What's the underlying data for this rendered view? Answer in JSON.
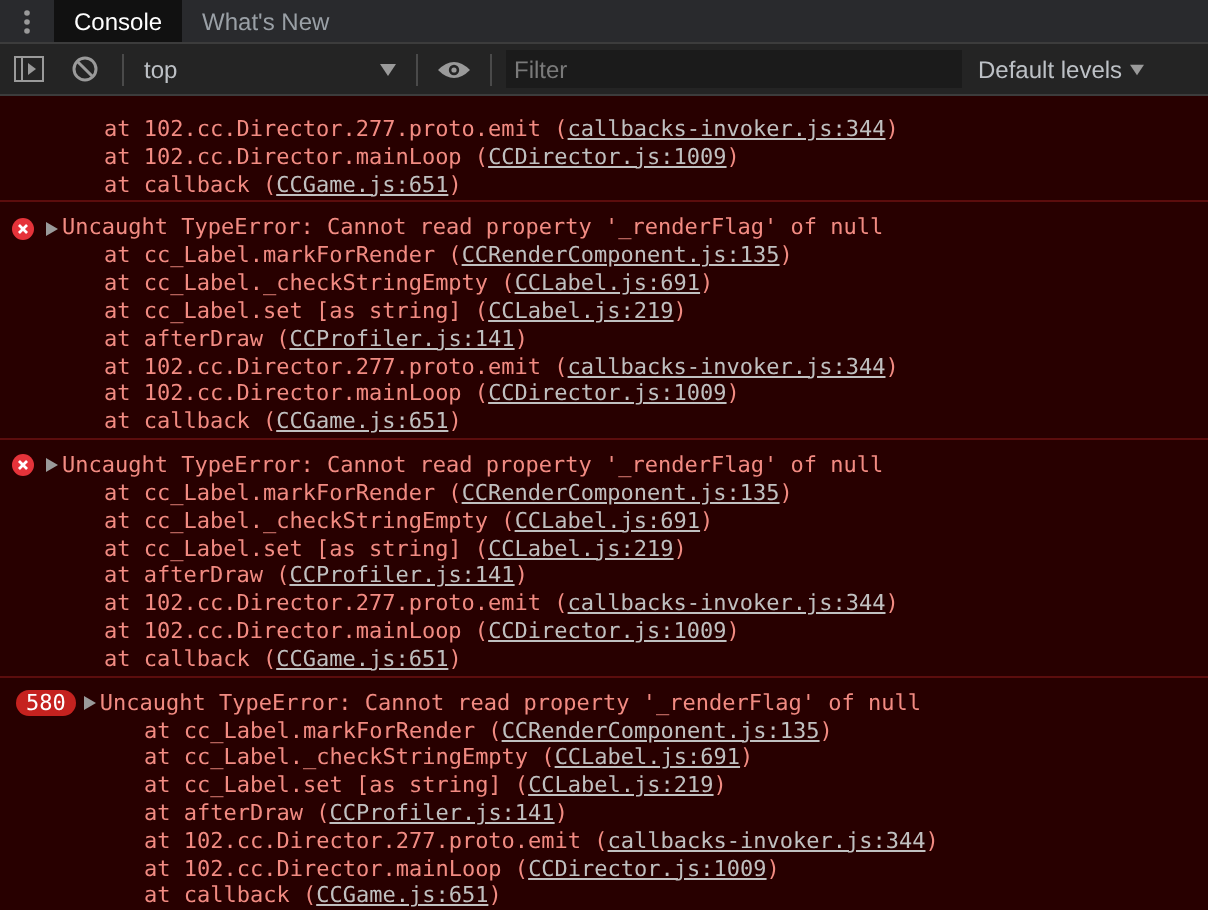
{
  "tabs": [
    {
      "label": "Console",
      "selected": true
    },
    {
      "label": "What's New",
      "selected": false
    }
  ],
  "toolbar": {
    "context": "top",
    "filter": {
      "placeholder": "Filter"
    },
    "levels": "Default levels"
  },
  "messages": [
    {
      "kind": "continuation",
      "frames": [
        {
          "before": "at 102.cc.Director.277.proto.emit (",
          "link": "callbacks-invoker.js:344",
          "after": ")"
        },
        {
          "before": "at 102.cc.Director.mainLoop (",
          "link": "CCDirector.js:1009",
          "after": ")"
        },
        {
          "before": "at callback (",
          "link": "CCGame.js:651",
          "after": ")"
        }
      ]
    },
    {
      "kind": "error",
      "text": "Uncaught TypeError: Cannot read property '_renderFlag' of null",
      "frames": [
        {
          "before": "at cc_Label.markForRender (",
          "link": "CCRenderComponent.js:135",
          "after": ")"
        },
        {
          "before": "at cc_Label._checkStringEmpty (",
          "link": "CCLabel.js:691",
          "after": ")"
        },
        {
          "before": "at cc_Label.set [as string] (",
          "link": "CCLabel.js:219",
          "after": ")"
        },
        {
          "before": "at afterDraw (",
          "link": "CCProfiler.js:141",
          "after": ")"
        },
        {
          "before": "at 102.cc.Director.277.proto.emit (",
          "link": "callbacks-invoker.js:344",
          "after": ")"
        },
        {
          "before": "at 102.cc.Director.mainLoop (",
          "link": "CCDirector.js:1009",
          "after": ")"
        },
        {
          "before": "at callback (",
          "link": "CCGame.js:651",
          "after": ")"
        }
      ]
    },
    {
      "kind": "error",
      "text": "Uncaught TypeError: Cannot read property '_renderFlag' of null",
      "frames": [
        {
          "before": "at cc_Label.markForRender (",
          "link": "CCRenderComponent.js:135",
          "after": ")"
        },
        {
          "before": "at cc_Label._checkStringEmpty (",
          "link": "CCLabel.js:691",
          "after": ")"
        },
        {
          "before": "at cc_Label.set [as string] (",
          "link": "CCLabel.js:219",
          "after": ")"
        },
        {
          "before": "at afterDraw (",
          "link": "CCProfiler.js:141",
          "after": ")"
        },
        {
          "before": "at 102.cc.Director.277.proto.emit (",
          "link": "callbacks-invoker.js:344",
          "after": ")"
        },
        {
          "before": "at 102.cc.Director.mainLoop (",
          "link": "CCDirector.js:1009",
          "after": ")"
        },
        {
          "before": "at callback (",
          "link": "CCGame.js:651",
          "after": ")"
        }
      ]
    },
    {
      "kind": "repeated",
      "count": "580",
      "text": "Uncaught TypeError: Cannot read property '_renderFlag' of null",
      "frames": [
        {
          "before": "at cc_Label.markForRender (",
          "link": "CCRenderComponent.js:135",
          "after": ")"
        },
        {
          "before": "at cc_Label._checkStringEmpty (",
          "link": "CCLabel.js:691",
          "after": ")"
        },
        {
          "before": "at cc_Label.set [as string] (",
          "link": "CCLabel.js:219",
          "after": ")"
        },
        {
          "before": "at afterDraw (",
          "link": "CCProfiler.js:141",
          "after": ")"
        },
        {
          "before": "at 102.cc.Director.277.proto.emit (",
          "link": "callbacks-invoker.js:344",
          "after": ")"
        },
        {
          "before": "at 102.cc.Director.mainLoop (",
          "link": "CCDirector.js:1009",
          "after": ")"
        },
        {
          "before": "at callback (",
          "link": "CCGame.js:651",
          "after": ")"
        }
      ]
    }
  ]
}
